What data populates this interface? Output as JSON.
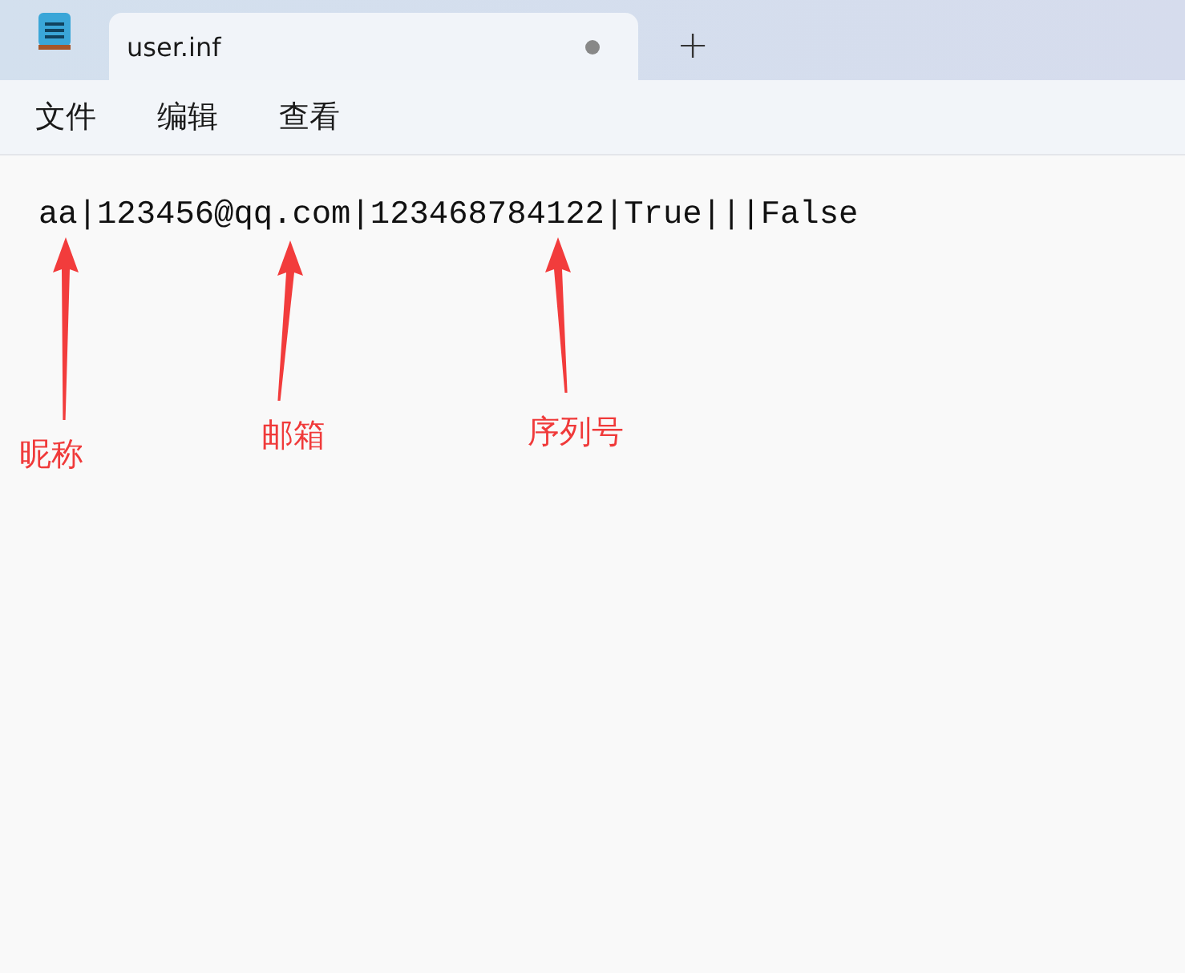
{
  "tabs": [
    {
      "title": "user.inf",
      "selected": true,
      "modified": true
    }
  ],
  "new_tab_button": "+",
  "menu": [
    "文件",
    "编辑",
    "查看"
  ],
  "editor": {
    "text": "aa|123456@qq.com|123468784122|True|||False"
  },
  "annotations": [
    {
      "label": "昵称"
    },
    {
      "label": "邮箱"
    },
    {
      "label": "序列号"
    }
  ]
}
